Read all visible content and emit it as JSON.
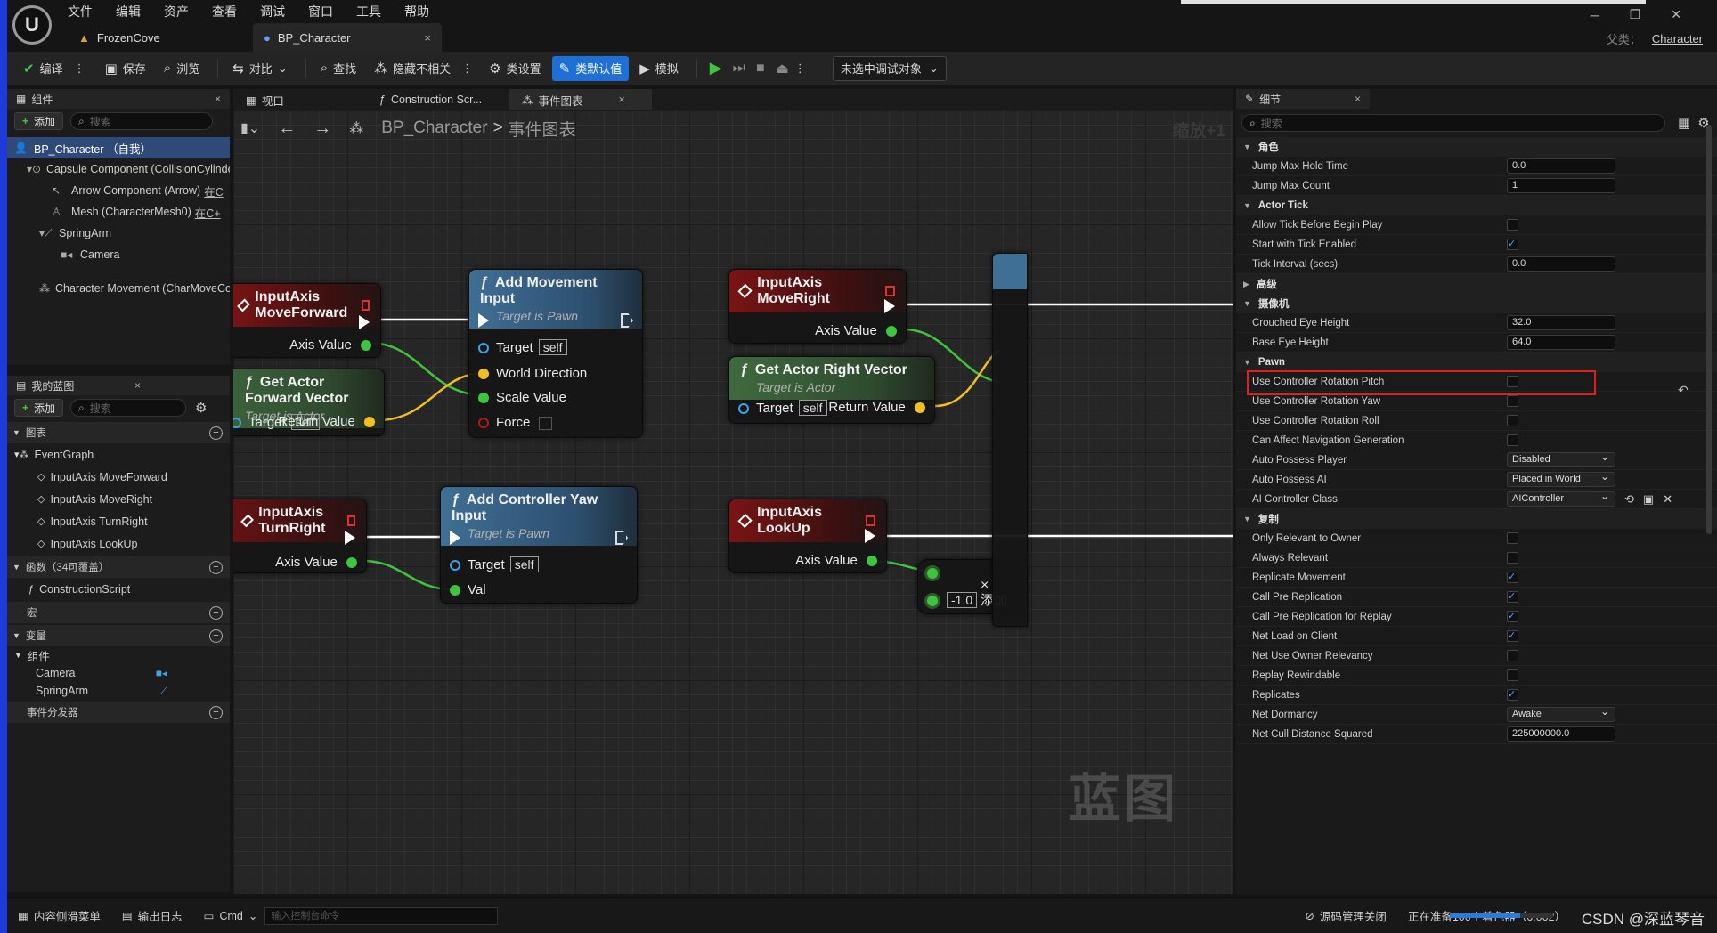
{
  "menu": [
    "文件",
    "编辑",
    "资产",
    "查看",
    "调试",
    "窗口",
    "工具",
    "帮助"
  ],
  "doc_tabs": [
    {
      "label": "FrozenCove"
    },
    {
      "label": "BP_Character",
      "close": "×"
    }
  ],
  "parent_class": {
    "label": "父类：",
    "value": "Character"
  },
  "toolbar": {
    "compile": "编译",
    "save": "保存",
    "browse": "浏览",
    "diff": "对比",
    "find": "查找",
    "hide_unrelated": "隐藏不相关",
    "class_settings": "类设置",
    "class_defaults": "类默认值",
    "simulate": "模拟",
    "debug_object": "未选中调试对象"
  },
  "components_panel": {
    "title": "组件",
    "add_label": "添加",
    "search_placeholder": "搜索",
    "items": [
      {
        "label": "BP_Character （自我）"
      },
      {
        "label": "Capsule Component (CollisionCylinder)"
      },
      {
        "label": "Arrow Component (Arrow)",
        "link": "在C"
      },
      {
        "label": "Mesh (CharacterMesh0)",
        "link": "在C+"
      },
      {
        "label": "SpringArm"
      },
      {
        "label": "Camera"
      },
      {
        "label": "Character Movement (CharMoveComp)"
      }
    ]
  },
  "my_blueprint": {
    "title": "我的蓝图",
    "add_label": "添加",
    "search_placeholder": "搜索",
    "graphs_label": "图表",
    "event_graph": "EventGraph",
    "events": [
      "InputAxis MoveForward",
      "InputAxis MoveRight",
      "InputAxis TurnRight",
      "InputAxis LookUp"
    ],
    "functions_label": "函数（34可覆盖）",
    "construction_script": "ConstructionScript",
    "macros_label": "宏",
    "variables_label": "变量",
    "components_label": "组件",
    "variables": [
      "Camera",
      "SpringArm"
    ],
    "dispatchers_label": "事件分发器"
  },
  "center_tabs": [
    {
      "label": "视口"
    },
    {
      "label": "Construction Scr..."
    },
    {
      "label": "事件图表",
      "close": "×"
    }
  ],
  "graph": {
    "breadcrumb_root": "BP_Character",
    "breadcrumb_sep": ">",
    "breadcrumb_leaf": "事件图表",
    "zoom": "缩放+1",
    "watermark": "蓝图",
    "nodes": {
      "move_forward": {
        "title": "InputAxis MoveForward",
        "pin": "Axis Value"
      },
      "get_forward": {
        "title": "Get Actor Forward Vector",
        "sub": "Target is Actor",
        "target": "Target",
        "self": "self",
        "ret": "Return Value"
      },
      "add_movement": {
        "title": "Add Movement Input",
        "sub": "Target is Pawn",
        "target": "Target",
        "self": "self",
        "world_dir": "World Direction",
        "scale": "Scale Value",
        "force": "Force"
      },
      "move_right": {
        "title": "InputAxis MoveRight",
        "pin": "Axis Value"
      },
      "get_right": {
        "title": "Get Actor Right Vector",
        "sub": "Target is Actor",
        "target": "Target",
        "self": "self",
        "ret": "Return Value"
      },
      "turn_right": {
        "title": "InputAxis TurnRight",
        "pin": "Axis Value"
      },
      "add_yaw": {
        "title": "Add Controller Yaw Input",
        "sub": "Target is Pawn",
        "target": "Target",
        "self": "self",
        "val": "Val"
      },
      "look_up": {
        "title": "InputAxis LookUp",
        "pin": "Axis Value"
      },
      "multiply": {
        "value": "-1.0",
        "add": "添加",
        "close": "×"
      }
    }
  },
  "details": {
    "title": "细节",
    "search_placeholder": "搜索",
    "sections": [
      {
        "name": "角色",
        "rows": [
          {
            "name": "Jump Max Hold Time",
            "type": "input",
            "value": "0.0"
          },
          {
            "name": "Jump Max Count",
            "type": "input",
            "value": "1"
          }
        ]
      },
      {
        "name": "Actor Tick",
        "rows": [
          {
            "name": "Allow Tick Before Begin Play",
            "type": "check",
            "checked": false
          },
          {
            "name": "Start with Tick Enabled",
            "type": "check",
            "checked": true
          },
          {
            "name": "Tick Interval (secs)",
            "type": "input",
            "value": "0.0"
          }
        ]
      },
      {
        "name": "高级",
        "collapsed": true,
        "rows": []
      },
      {
        "name": "摄像机",
        "rows": [
          {
            "name": "Crouched Eye Height",
            "type": "input",
            "value": "32.0"
          },
          {
            "name": "Base Eye Height",
            "type": "input",
            "value": "64.0"
          }
        ]
      },
      {
        "name": "Pawn",
        "rows": [
          {
            "name": "Use Controller Rotation Pitch",
            "type": "check",
            "checked": false
          },
          {
            "name": "Use Controller Rotation Yaw",
            "type": "check",
            "checked": false,
            "highlight": true
          },
          {
            "name": "Use Controller Rotation Roll",
            "type": "check",
            "checked": false
          },
          {
            "name": "Can Affect Navigation Generation",
            "type": "check",
            "checked": false
          },
          {
            "name": "Auto Possess Player",
            "type": "select",
            "value": "Disabled"
          },
          {
            "name": "Auto Possess AI",
            "type": "select",
            "value": "Placed in World"
          },
          {
            "name": "AI Controller Class",
            "type": "select",
            "value": "AIController"
          }
        ]
      },
      {
        "name": "复制",
        "rows": [
          {
            "name": "Only Relevant to Owner",
            "type": "check",
            "checked": false
          },
          {
            "name": "Always Relevant",
            "type": "check",
            "checked": false
          },
          {
            "name": "Replicate Movement",
            "type": "check",
            "checked": true
          },
          {
            "name": "Call Pre Replication",
            "type": "check",
            "checked": true
          },
          {
            "name": "Call Pre Replication for Replay",
            "type": "check",
            "checked": true
          },
          {
            "name": "Net Load on Client",
            "type": "check",
            "checked": true
          },
          {
            "name": "Net Use Owner Relevancy",
            "type": "check",
            "checked": false
          },
          {
            "name": "Replay Rewindable",
            "type": "check",
            "checked": false
          },
          {
            "name": "Replicates",
            "type": "check",
            "checked": true
          },
          {
            "name": "Net Dormancy",
            "type": "select",
            "value": "Awake"
          },
          {
            "name": "Net Cull Distance Squared",
            "type": "input",
            "value": "225000000.0"
          }
        ]
      }
    ]
  },
  "statusbar": {
    "content_drawer": "内容侧滑菜单",
    "output_log": "输出日志",
    "cmd": "Cmd",
    "cmd_placeholder": "输入控制台命令",
    "source_control": "源码管理关闭",
    "shader_status": "正在准备100个着色器（6,002）",
    "progress": 0.68,
    "csdn": "CSDN @深蓝琴音"
  },
  "colors": {
    "accent": "#1f6fd9",
    "highlight_box": "#e02020",
    "exec_wire": "#ffffff",
    "float_wire": "#3ec43e",
    "vector_wire": "#f0c020"
  }
}
